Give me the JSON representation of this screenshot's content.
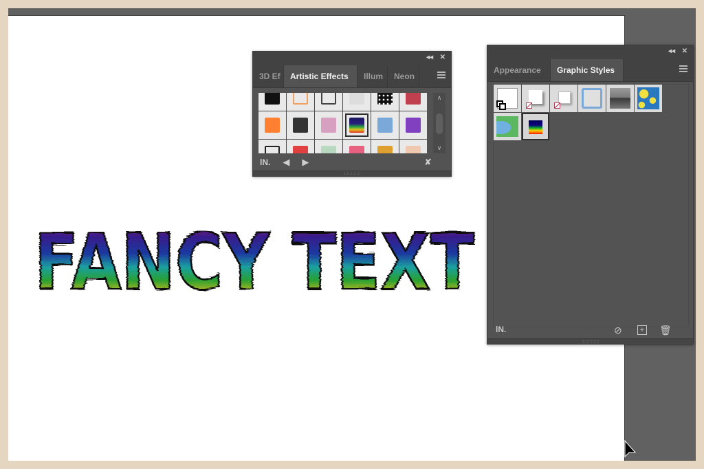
{
  "canvas": {
    "fancy_text": "FANCY TEXT",
    "artboard_color": "#ffffff",
    "workspace_color": "#616161"
  },
  "artistic_effects_panel": {
    "collapse_icon": "double-chevron-left-icon",
    "close_icon": "close-icon",
    "tabs": [
      {
        "label": "3D Ef",
        "active": false
      },
      {
        "label": "Artistic Effects",
        "active": true
      },
      {
        "label": "Illum",
        "active": false
      },
      {
        "label": "Neon",
        "active": false
      }
    ],
    "menu_icon": "hamburger-menu-icon",
    "swatches": [
      {
        "name": "black-fill",
        "color": "#111111"
      },
      {
        "name": "orange-corner-stroke",
        "color": "#f0a060"
      },
      {
        "name": "rough-square-stroke",
        "color": "#444444"
      },
      {
        "name": "light-grey-blur",
        "color": "#dddddd"
      },
      {
        "name": "black-dots",
        "color": "#222222"
      },
      {
        "name": "red-texture",
        "color": "#c04050"
      },
      {
        "name": "orange-watercolor",
        "color": "#ff8030"
      },
      {
        "name": "scribble-black",
        "color": "#333333"
      },
      {
        "name": "pink-bevel",
        "color": "#d8a0c0"
      },
      {
        "name": "rainbow-scratch",
        "color": "#1a1a60",
        "selected": true
      },
      {
        "name": "hexagon-mosaic",
        "color": "#7aa8d8"
      },
      {
        "name": "purple-brush",
        "color": "#8040c0"
      },
      {
        "name": "rough-white-frame",
        "color": "#222222"
      },
      {
        "name": "red-splatter",
        "color": "#e04040"
      },
      {
        "name": "pastel-blur",
        "color": "#b8d8c0"
      },
      {
        "name": "colorful-pop",
        "color": "#e86080"
      },
      {
        "name": "orange-texture",
        "color": "#e0a030"
      },
      {
        "name": "peach-blur",
        "color": "#f0c8b0"
      }
    ],
    "footer": {
      "library_icon": "library-icon",
      "prev_icon": "triangle-left-icon",
      "next_icon": "triangle-right-icon",
      "break_link_icon": "break-link-icon"
    }
  },
  "graphic_styles_panel": {
    "collapse_icon": "double-chevron-left-icon",
    "close_icon": "close-icon",
    "tabs": [
      {
        "label": "Appearance",
        "active": false
      },
      {
        "label": "Graphic Styles",
        "active": true
      }
    ],
    "menu_icon": "hamburger-menu-icon",
    "styles": [
      {
        "name": "default-graphic-style"
      },
      {
        "name": "drop-shadow-style"
      },
      {
        "name": "drop-shadow-small-style"
      },
      {
        "name": "blue-outline-style"
      },
      {
        "name": "grey-gradient-style"
      },
      {
        "name": "yellow-blue-pattern-style"
      },
      {
        "name": "green-blue-pattern-style"
      },
      {
        "name": "rainbow-scratch-style",
        "selected": true
      }
    ],
    "footer": {
      "library_icon": "library-icon",
      "break_link_icon": "break-link-to-graphic-style-icon",
      "new_style_icon": "new-graphic-style-icon",
      "delete_icon": "trash-icon"
    }
  }
}
